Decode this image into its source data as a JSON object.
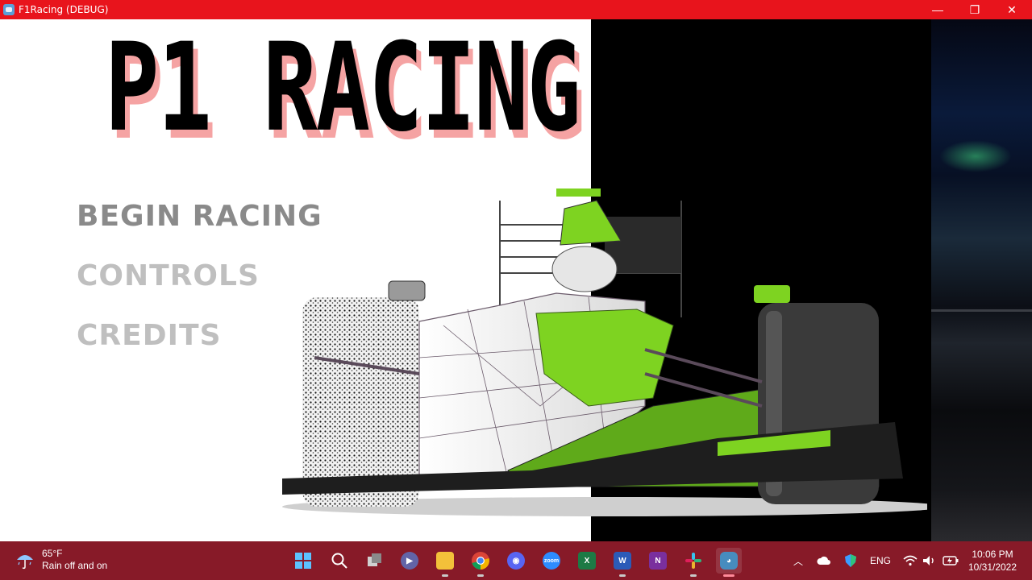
{
  "window": {
    "title": "F1Racing (DEBUG)",
    "minimize_glyph": "—",
    "maximize_glyph": "❐",
    "close_glyph": "✕"
  },
  "game": {
    "logo_text": "P1 RACING",
    "menu": {
      "begin_label": "BEGIN RACING",
      "controls_label": "CONTROLS",
      "credits_label": "CREDITS"
    }
  },
  "colors": {
    "titlebar": "#e8141c",
    "taskbar": "#871a28",
    "car_green": "#7ed321",
    "logo_shadow": "#f5a3a3"
  },
  "taskbar": {
    "weather_temp": "65°F",
    "weather_desc": "Rain off and on",
    "apps": [
      {
        "name": "start-icon",
        "label": ""
      },
      {
        "name": "search-icon",
        "label": ""
      },
      {
        "name": "task-view-icon",
        "label": ""
      },
      {
        "name": "teams-icon",
        "label": ""
      },
      {
        "name": "file-explorer-icon",
        "label": ""
      },
      {
        "name": "chrome-icon",
        "label": ""
      },
      {
        "name": "discord-icon",
        "label": ""
      },
      {
        "name": "zoom-icon",
        "label": "zoom"
      },
      {
        "name": "excel-icon",
        "label": "X"
      },
      {
        "name": "word-icon",
        "label": "W"
      },
      {
        "name": "onenote-icon",
        "label": "N"
      },
      {
        "name": "slack-icon",
        "label": ""
      },
      {
        "name": "godot-icon",
        "label": ""
      }
    ],
    "tray": {
      "language": "ENG",
      "time": "10:06 PM",
      "date": "10/31/2022"
    }
  }
}
